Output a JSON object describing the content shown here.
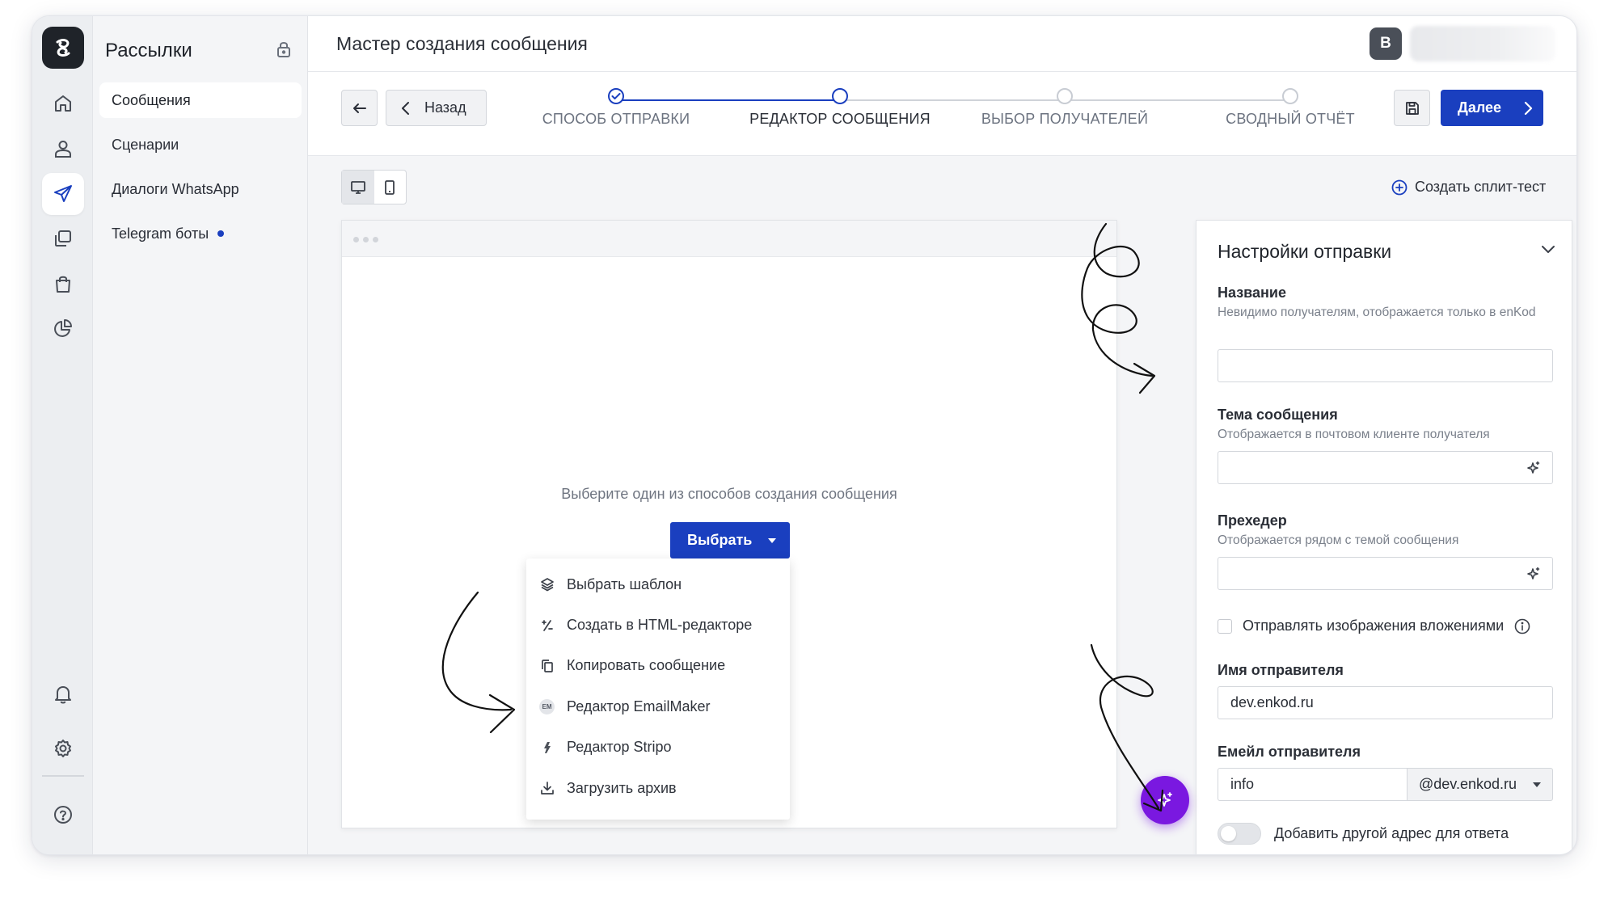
{
  "nav": {
    "title": "Рассылки",
    "items": [
      {
        "label": "Сообщения",
        "active": true
      },
      {
        "label": "Сценарии"
      },
      {
        "label": "Диалоги WhatsApp"
      },
      {
        "label": "Telegram боты",
        "dot": true
      }
    ]
  },
  "rail": {
    "icons": [
      "logo-icon",
      "home-icon",
      "user-icon",
      "send-icon",
      "copy-icon",
      "bag-icon",
      "pie-chart-icon",
      "bell-icon",
      "settings-icon",
      "help-icon"
    ],
    "active": "send-icon"
  },
  "header": {
    "title": "Мастер создания сообщения",
    "avatar_letter": "B"
  },
  "wizard": {
    "back_label": "Назад",
    "next_label": "Далее",
    "steps": [
      {
        "label": "СПОСОБ ОТПРАВКИ",
        "state": "done"
      },
      {
        "label": "РЕДАКТОР СООБЩЕНИЯ",
        "state": "current"
      },
      {
        "label": "ВЫБОР ПОЛУЧАТЕЛЕЙ",
        "state": "todo"
      },
      {
        "label": "СВОДНЫЙ ОТЧЁТ",
        "state": "todo"
      }
    ]
  },
  "toolbar": {
    "view_active": "desktop",
    "split_test_label": "Создать сплит-тест"
  },
  "editor": {
    "hint": "Выберите один из способов создания сообщения",
    "choose_label": "Выбрать",
    "menu": [
      {
        "label": "Выбрать шаблон",
        "icon": "layers-icon"
      },
      {
        "label": "Создать в HTML-редакторе",
        "icon": "code-slash-icon"
      },
      {
        "label": "Копировать сообщение",
        "icon": "copy-icon"
      },
      {
        "label": "Редактор EmailMaker",
        "icon": "emailmaker-icon",
        "badge": "EM"
      },
      {
        "label": "Редактор Stripo",
        "icon": "stripo-icon"
      },
      {
        "label": "Загрузить архив",
        "icon": "download-icon"
      }
    ]
  },
  "settings": {
    "title": "Настройки отправки",
    "name_label": "Название",
    "name_hint": "Невидимо получателям, отображается только в enKod",
    "name_value": "",
    "subject_label": "Тема сообщения",
    "subject_hint": "Отображается в почтовом клиенте получателя",
    "subject_value": "",
    "preheader_label": "Прехедер",
    "preheader_hint": "Отображается рядом с темой сообщения",
    "preheader_value": "",
    "attach_images_label": "Отправлять изображения вложениями",
    "attach_images_checked": false,
    "sender_name_label": "Имя отправителя",
    "sender_name_value": "dev.enkod.ru",
    "sender_email_label": "Емейл отправителя",
    "sender_email_local": "info",
    "sender_email_domain": "@dev.enkod.ru",
    "reply_to_label": "Добавить другой адрес для ответа",
    "reply_to_enabled": false
  },
  "colors": {
    "primary": "#1a3fbf",
    "fab": "#7a18e0",
    "rail_logo": "#1f2329"
  }
}
